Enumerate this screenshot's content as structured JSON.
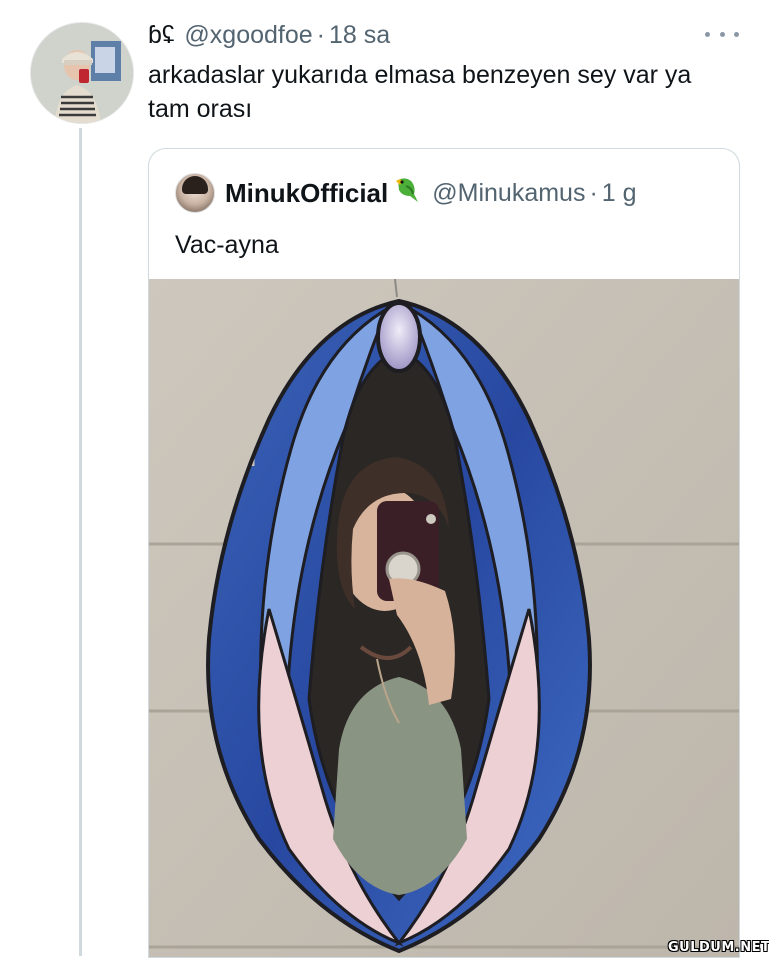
{
  "tweet": {
    "display_name": "ɓʢ",
    "handle": "@xgoodfoe",
    "separator": "·",
    "time": "18 sa",
    "text": "arkadaslar yukarıda elmasa benzeyen sey var ya tam orası",
    "more_icon": "more-horizontal-icon"
  },
  "quote": {
    "display_name": "MinukOfficial",
    "emoji_icon": "parrot-icon",
    "handle": "@Minukamus",
    "separator": "·",
    "time": "1 g",
    "text": "Vac-ayna"
  },
  "watermark": "GULDUM.NET",
  "colors": {
    "mirror_dark_blue": "#2f56a8",
    "mirror_light_blue": "#7fa2e2",
    "mirror_pink": "#ecd0d4",
    "gem_lavender": "#c7bde0",
    "wall": "#c8c2b8",
    "thread_line": "#cfd9de"
  }
}
